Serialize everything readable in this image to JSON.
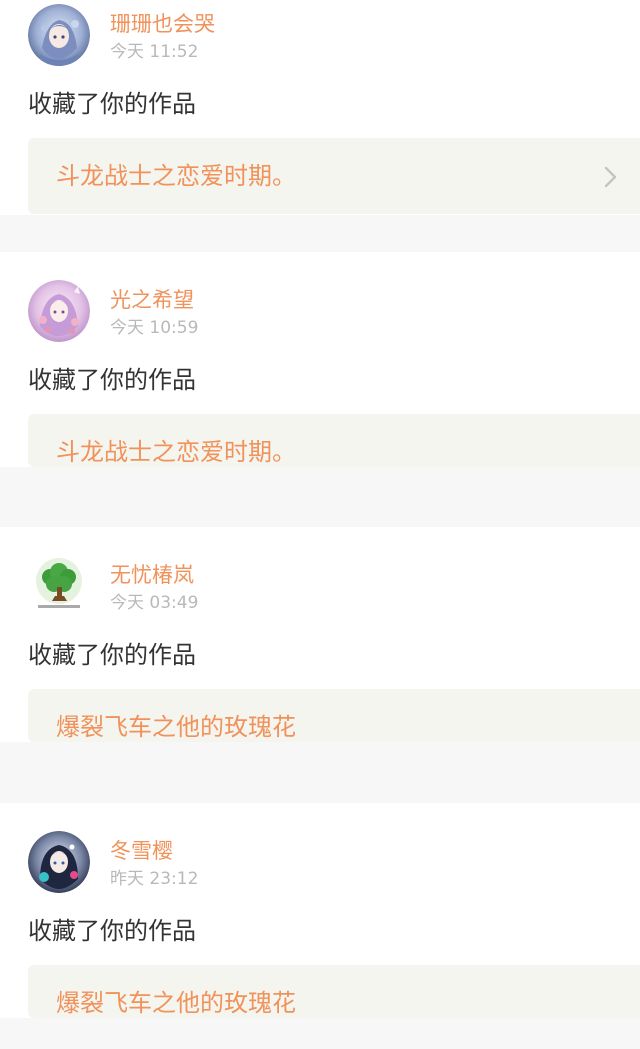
{
  "feed": [
    {
      "username": "珊珊也会哭",
      "time": "今天 11:52",
      "action": "收藏了你的作品",
      "work_title": "斗龙战士之恋爱时期。",
      "avatar_icon": "anime-girl-avatar-icon"
    },
    {
      "username": "光之希望",
      "time": "今天 10:59",
      "action": "收藏了你的作品",
      "work_title": "斗龙战士之恋爱时期。",
      "avatar_icon": "anime-girl-avatar-icon"
    },
    {
      "username": "无忧椿岚",
      "time": "今天 03:49",
      "action": "收藏了你的作品",
      "work_title": "爆裂飞车之他的玫瑰花",
      "avatar_icon": "tree-avatar-icon"
    },
    {
      "username": "冬雪樱",
      "time": "昨天 23:12",
      "action": "收藏了你的作品",
      "work_title": "爆裂飞车之他的玫瑰花",
      "avatar_icon": "anime-girl-avatar-icon"
    }
  ],
  "colors": {
    "accent": "#f0925a",
    "timestamp": "#b9b9b9",
    "body_text": "#333333",
    "link_bg": "#f5f5f0",
    "separator": "#f7f7f7"
  },
  "icons": {
    "chevron": "chevron-right-icon"
  }
}
